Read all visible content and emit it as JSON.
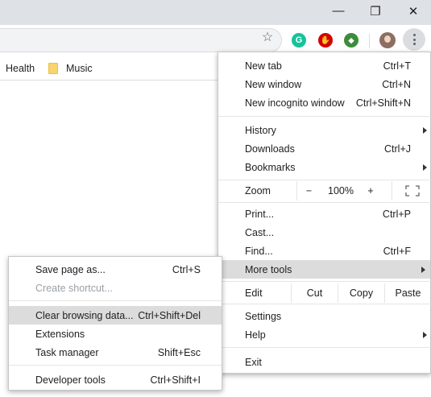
{
  "window_controls": {
    "minimize": "—",
    "restore": "❐",
    "close": "✕"
  },
  "extensions": [
    {
      "name": "grammarly-icon",
      "color": "#15c39a",
      "glyph": "G"
    },
    {
      "name": "adblock-icon",
      "color": "#d50000",
      "glyph": "✋"
    },
    {
      "name": "globe-extension-icon",
      "color": "#3c8c3c",
      "glyph": "◆"
    }
  ],
  "bookmarks": [
    {
      "label": "Health"
    },
    {
      "label": "Music"
    }
  ],
  "chrome_menu": {
    "new_tab": {
      "label": "New tab",
      "shortcut": "Ctrl+T"
    },
    "new_window": {
      "label": "New window",
      "shortcut": "Ctrl+N"
    },
    "new_incognito": {
      "label": "New incognito window",
      "shortcut": "Ctrl+Shift+N"
    },
    "history": {
      "label": "History"
    },
    "downloads": {
      "label": "Downloads",
      "shortcut": "Ctrl+J"
    },
    "bookmarks": {
      "label": "Bookmarks"
    },
    "zoom": {
      "label": "Zoom",
      "minus": "−",
      "value": "100%",
      "plus": "+"
    },
    "print": {
      "label": "Print...",
      "shortcut": "Ctrl+P"
    },
    "cast": {
      "label": "Cast..."
    },
    "find": {
      "label": "Find...",
      "shortcut": "Ctrl+F"
    },
    "more_tools": {
      "label": "More tools"
    },
    "edit": {
      "label": "Edit",
      "cut": "Cut",
      "copy": "Copy",
      "paste": "Paste"
    },
    "settings": {
      "label": "Settings"
    },
    "help": {
      "label": "Help"
    },
    "exit": {
      "label": "Exit"
    }
  },
  "more_tools_menu": {
    "save_page": {
      "label": "Save page as...",
      "shortcut": "Ctrl+S"
    },
    "create_shortcut": {
      "label": "Create shortcut..."
    },
    "clear_browsing": {
      "label": "Clear browsing data...",
      "shortcut": "Ctrl+Shift+Del"
    },
    "extensions": {
      "label": "Extensions"
    },
    "task_manager": {
      "label": "Task manager",
      "shortcut": "Shift+Esc"
    },
    "developer_tools": {
      "label": "Developer tools",
      "shortcut": "Ctrl+Shift+I"
    }
  }
}
